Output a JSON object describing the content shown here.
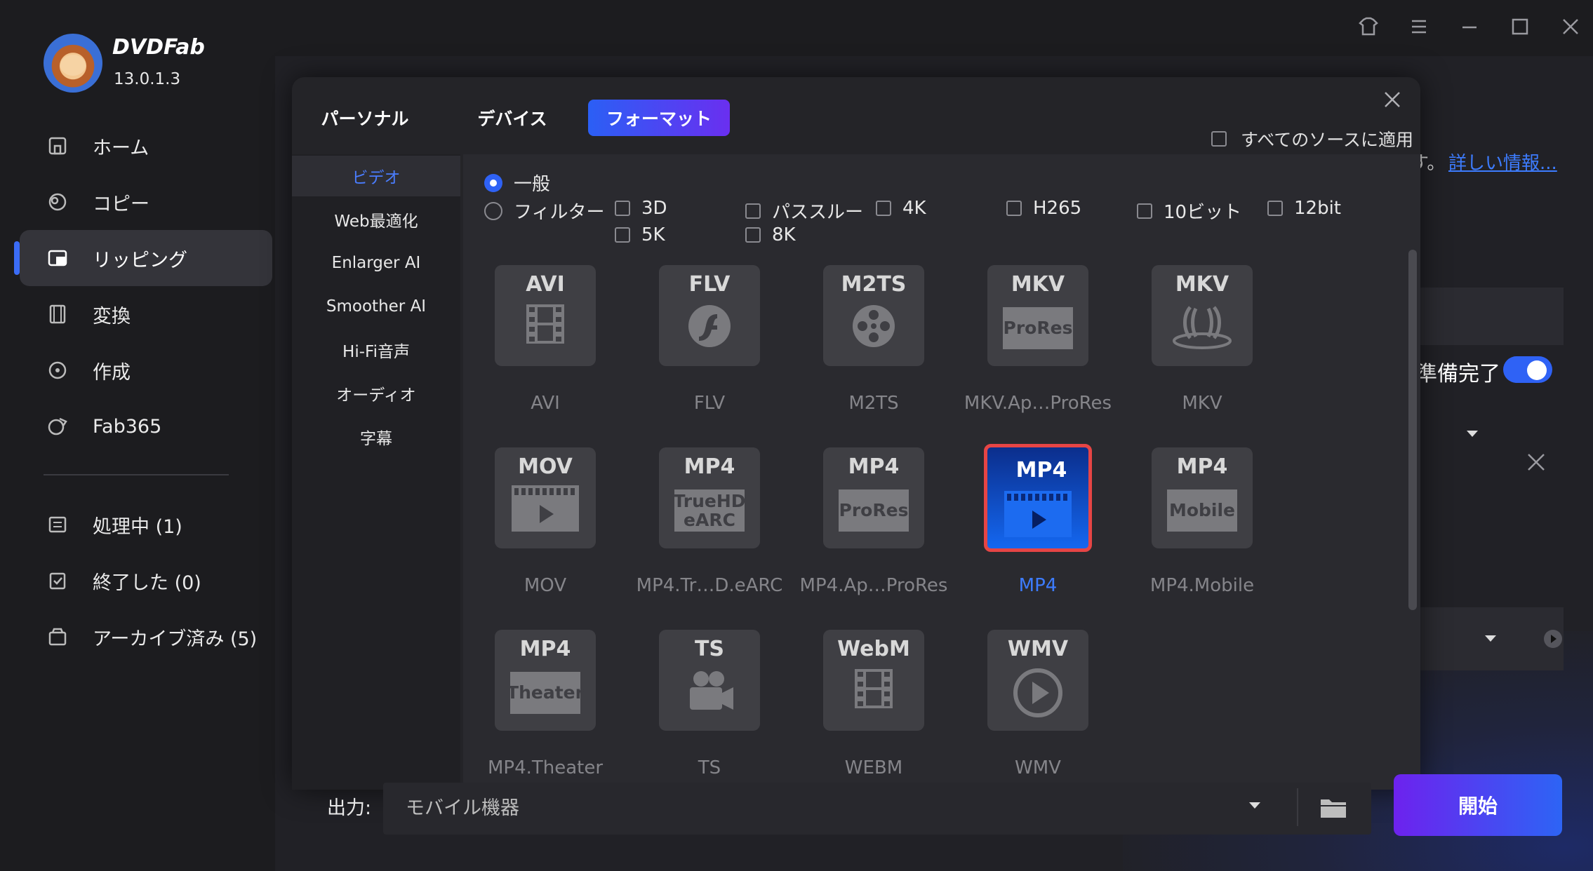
{
  "app": {
    "name": "DVDFab",
    "version": "13.0.1.3"
  },
  "sidebar": {
    "items": [
      {
        "label": "ホーム",
        "icon": "home-icon"
      },
      {
        "label": "コピー",
        "icon": "copy-icon"
      },
      {
        "label": "リッピング",
        "icon": "ripping-icon",
        "active": true
      },
      {
        "label": "変換",
        "icon": "convert-icon"
      },
      {
        "label": "作成",
        "icon": "create-icon"
      },
      {
        "label": "Fab365",
        "icon": "fab365-icon"
      }
    ],
    "queue": [
      {
        "label": "処理中 (1)",
        "icon": "processing-icon"
      },
      {
        "label": "終了した (0)",
        "icon": "finished-icon"
      },
      {
        "label": "アーカイブ済み (5)",
        "icon": "archive-icon"
      }
    ]
  },
  "behind": {
    "text": "す。",
    "link": "詳しい情報...",
    "ready": "準備完了"
  },
  "modal": {
    "tabs": [
      "パーソナル",
      "デバイス",
      "フォーマット"
    ],
    "active_tab": 2,
    "apply_all": "すべてのソースに適用",
    "submenu": [
      "ビデオ",
      "Web最適化",
      "Enlarger AI",
      "Smoother AI",
      "Hi-Fi音声",
      "オーディオ",
      "字幕"
    ],
    "active_submenu": 0,
    "radio": {
      "general": "一般",
      "filter": "フィルター"
    },
    "filters": [
      "3D",
      "パススルー",
      "4K",
      "H265",
      "10ビット",
      "12bit",
      "5K",
      "8K"
    ],
    "formats": [
      {
        "top": "AVI",
        "inner": "",
        "label": "AVI",
        "kind": "film"
      },
      {
        "top": "FLV",
        "inner": "",
        "label": "FLV",
        "kind": "flash"
      },
      {
        "top": "M2TS",
        "inner": "",
        "label": "M2TS",
        "kind": "reel"
      },
      {
        "top": "MKV",
        "inner": "ProRes",
        "label": "MKV.Ap…ProRes",
        "kind": "box"
      },
      {
        "top": "MKV",
        "inner": "",
        "label": "MKV",
        "kind": "mkv"
      },
      {
        "top": "MOV",
        "inner": "",
        "label": "MOV",
        "kind": "play"
      },
      {
        "top": "MP4",
        "inner": "TrueHD eARC",
        "label": "MP4.Tr…D.eARC",
        "kind": "box"
      },
      {
        "top": "MP4",
        "inner": "ProRes",
        "label": "MP4.Ap…ProRes",
        "kind": "box"
      },
      {
        "top": "MP4",
        "inner": "",
        "label": "MP4",
        "kind": "play",
        "selected": true
      },
      {
        "top": "MP4",
        "inner": "Mobile",
        "label": "MP4.Mobile",
        "kind": "box"
      },
      {
        "top": "MP4",
        "inner": "Theater",
        "label": "MP4.Theater",
        "kind": "box"
      },
      {
        "top": "TS",
        "inner": "",
        "label": "TS",
        "kind": "camera"
      },
      {
        "top": "WebM",
        "inner": "",
        "label": "WEBM",
        "kind": "film"
      },
      {
        "top": "WMV",
        "inner": "",
        "label": "WMV",
        "kind": "circleplay"
      }
    ]
  },
  "output": {
    "label": "出力:",
    "value": "モバイル機器"
  },
  "start_label": "開始",
  "colors": {
    "accent": "#2f62f5",
    "selected_border": "#e64545",
    "link": "#3d7cff"
  }
}
